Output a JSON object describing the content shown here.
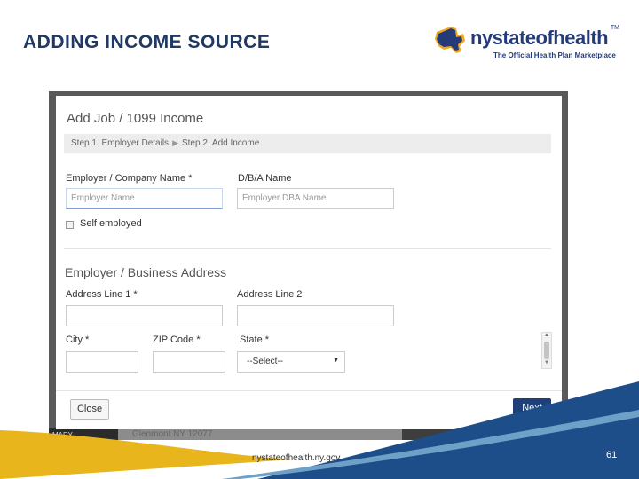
{
  "slide": {
    "title": "ADDING INCOME SOURCE",
    "footer_url": "nystateofhealth.ny.gov",
    "page_number": "61"
  },
  "logo": {
    "name": "nystateofhealth",
    "tagline": "The Official Health Plan Marketplace",
    "trademark": "TM"
  },
  "background_app": {
    "row_left_text": "MARY",
    "row_mid_text": "Glenmont NY  12077"
  },
  "modal": {
    "title": "Add Job / 1099 Income",
    "breadcrumb": {
      "step1": "Step 1. Employer Details",
      "separator_icon": "chevron-right-icon",
      "step2": "Step 2. Add Income"
    },
    "employer_name": {
      "label": "Employer / Company Name *",
      "placeholder": "Employer Name"
    },
    "dba_name": {
      "label": "D/B/A Name",
      "placeholder": "Employer DBA Name"
    },
    "self_employed": {
      "label": "Self employed",
      "checked": false
    },
    "address_section_title": "Employer / Business Address",
    "address_line1": {
      "label": "Address Line 1 *",
      "value": ""
    },
    "address_line2": {
      "label": "Address Line 2",
      "value": ""
    },
    "city": {
      "label": "City *",
      "value": ""
    },
    "zip": {
      "label": "ZIP Code *",
      "value": ""
    },
    "state": {
      "label": "State *",
      "selected": "--Select--"
    },
    "buttons": {
      "close": "Close",
      "next": "Next"
    }
  },
  "colors": {
    "title_navy": "#1f3864",
    "next_button": "#1e3f78",
    "wave_blue": "#1d4e89",
    "wave_gold": "#e8b61c"
  }
}
